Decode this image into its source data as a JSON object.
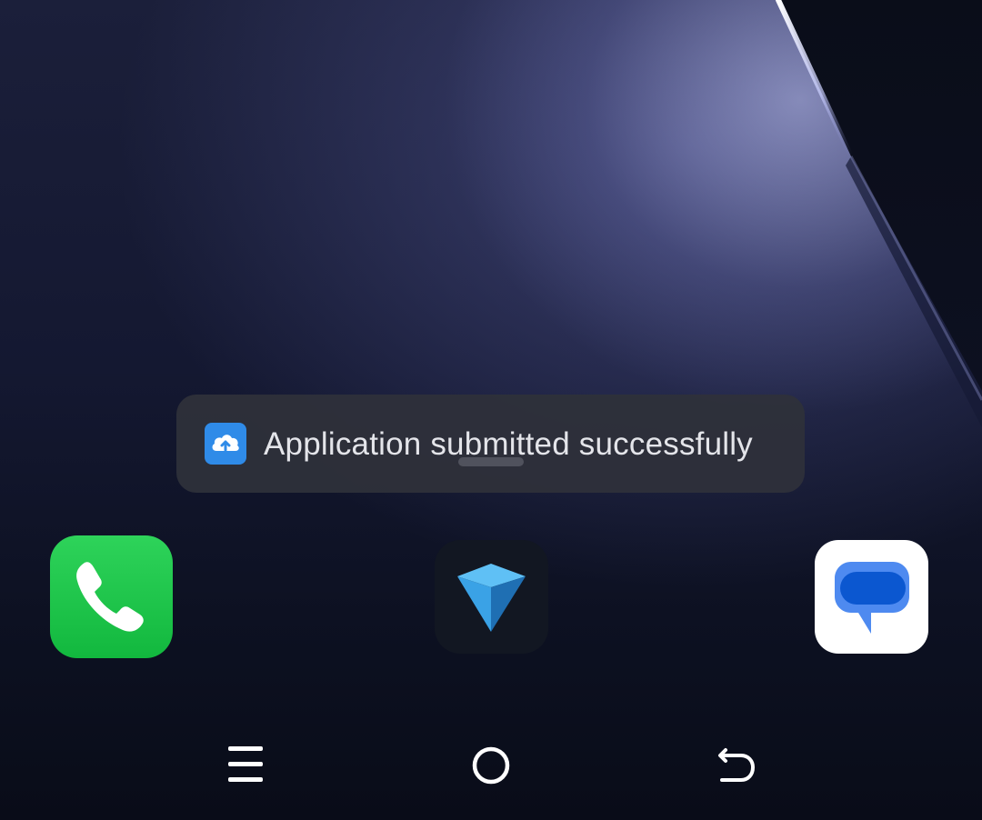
{
  "toast": {
    "icon": "cloud-upload-icon",
    "message": "Application submitted successfully"
  },
  "dock": {
    "apps": [
      {
        "name": "Phone",
        "icon": "phone-icon",
        "color": "#1fc84c"
      },
      {
        "name": "Gem app",
        "icon": "gem-icon",
        "color": "#121722"
      },
      {
        "name": "Messages",
        "icon": "messages-icon",
        "color": "#ffffff"
      }
    ]
  },
  "navigation": {
    "buttons": [
      {
        "name": "Recent apps",
        "icon": "menu-icon"
      },
      {
        "name": "Home",
        "icon": "home-circle-icon"
      },
      {
        "name": "Back",
        "icon": "back-icon"
      }
    ]
  },
  "colors": {
    "toast_background": "#2e303a",
    "toast_icon_background": "#2f8be8",
    "wallpaper": "#141831"
  }
}
